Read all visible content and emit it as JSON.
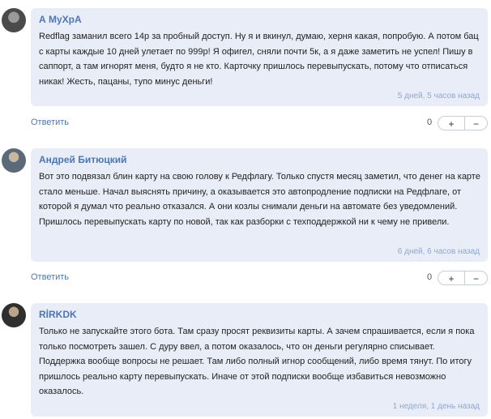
{
  "comments": [
    {
      "author": "А МуХрА",
      "text": "Redflag заманил всего 14р за пробный доступ. Ну я и вкинул, думаю, херня какая, попробую. А потом бац с карты каждые 10 дней улетает по 999р! Я офигел, сняли почти 5к, а я даже заметить не успел! Пишу в саппорт, а там игнорят меня, будто я не кто. Карточку пришлось перевыпускать, потому что отписаться никак! Жесть, пацаны, тупо минус деньги!",
      "time": "5 дней, 5 часов назад",
      "reply": "Ответить",
      "score": "0",
      "plus": "+",
      "minus": "−"
    },
    {
      "author": "Андрей Битюцкий",
      "text": "Вот это подвязал блин карту на свою голову к Редфлагу. Только спустя месяц заметил, что денег на карте стало меньше. Начал выяснять причину, а оказывается это автопродление подписки на Редфлаге, от которой я думал что реально отказался. А они козлы снимали деньги на автомате без уведомлений. Пришлось перевыпускать карту по новой, так как разборки с техподдержкой ни к чему не привели.",
      "time": "6 дней, 6 часов назад",
      "reply": "Ответить",
      "score": "0",
      "plus": "+",
      "minus": "−"
    },
    {
      "author": "RİRKDK",
      "text": "Только не запускайте этого бота. Там сразу просят реквизиты карты. А зачем спрашивается, если я пока только посмотреть зашел. С дуру ввел, а потом оказалось, что он деньги регулярно списывает. Поддержка вообще вопросы не решает. Там либо полный игнор сообщений, либо время тянут. По итогу пришлось реально карту перевыпускать. Иначе от этой подписки вообще избавиться невозможно оказалось.",
      "time": "1 неделя, 1 день назад"
    }
  ]
}
